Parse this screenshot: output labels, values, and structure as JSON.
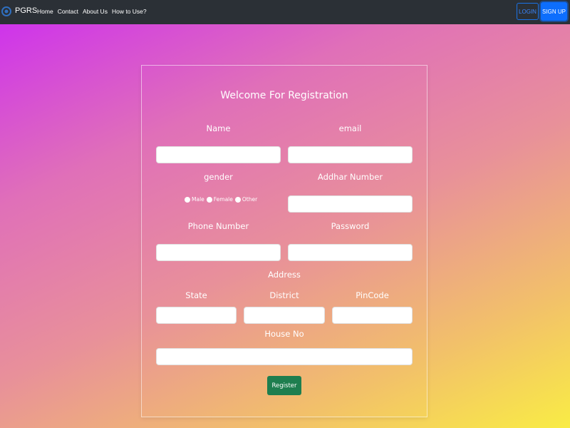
{
  "navbar": {
    "brand": "PGRS",
    "links": [
      "Home",
      "Contact",
      "About Us",
      "How to Use?"
    ],
    "login_label": "LOGIN",
    "signup_label": "SIGN UP",
    "background_color": "#2b3036"
  },
  "form": {
    "title": "Welcome For Registration",
    "labels": {
      "name": "Name",
      "email": "email",
      "gender": "gender",
      "aadhar": "Addhar Number",
      "phone": "Phone Number",
      "password": "Password",
      "address": "Address",
      "state": "State",
      "district": "District",
      "pincode": "PinCode",
      "house_no": "House No"
    },
    "gender_options": [
      "Male",
      "Female",
      "Other"
    ],
    "values": {
      "name": "",
      "email": "",
      "aadhar": "",
      "phone": "",
      "password": "",
      "state": "",
      "district": "",
      "pincode": "",
      "house_no": ""
    },
    "register_label": "Register",
    "register_color": "#1e7e4f"
  }
}
